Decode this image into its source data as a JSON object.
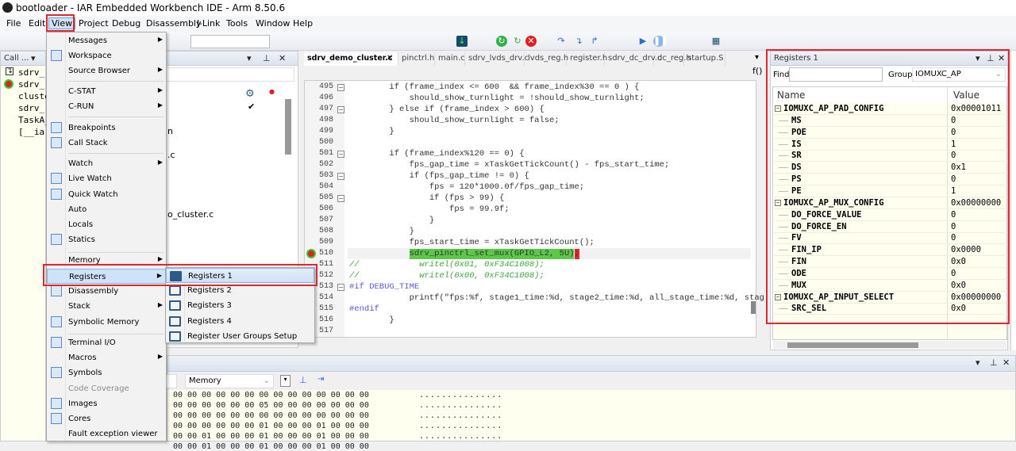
{
  "window": {
    "title": "bootloader - IAR Embedded Workbench IDE - Arm 8.50.6"
  },
  "menubar": [
    "File",
    "Edit",
    "View",
    "Project",
    "Debug",
    "Disassembly",
    "J-Link",
    "Tools",
    "Window",
    "Help"
  ],
  "callstack": {
    "title": "Call ...",
    "items": [
      "sdrv_",
      "sdrv_",
      "cluste",
      "sdrv_",
      "TaskA_",
      "[__ia"
    ]
  },
  "workspace": {
    "fragments": [
      "n",
      ".c",
      "o_cluster.c"
    ]
  },
  "editor": {
    "tabs": [
      "sdrv_demo_cluster.c",
      "pinctrl.h",
      "main.c",
      "sdrv_lvds_drv.c",
      "lvds_reg.h",
      "register.h",
      "sdrv_dc_drv.c",
      "dc_reg.h",
      "startup.S"
    ],
    "func_icon": "f()",
    "line_numbers": [
      "495",
      "496",
      "497",
      "498",
      "499",
      "500",
      "501",
      "502",
      "503",
      "504",
      "505",
      "506",
      "507",
      "508",
      "509",
      "510",
      "511",
      "512",
      "513",
      "514",
      "515",
      "516",
      "517"
    ],
    "current_line": "510",
    "lines": [
      "        if (frame_index <= 600  && frame_index%30 == 0 ) {",
      "            should_show_turnlight = !should_show_turnlight;",
      "        } else if (frame_index > 600) {",
      "            should_show_turnlight = false;",
      "        }",
      "",
      "        if (frame_index%120 == 0) {",
      "            fps_gap_time = xTaskGetTickCount() - fps_start_time;",
      "            if (fps_gap_time != 0) {",
      "                fps = 120*1000.0f/fps_gap_time;",
      "                if (fps > 99) {",
      "                    fps = 99.9f;",
      "                }",
      "            }",
      "            fps_start_time = xTaskGetTickCount();",
      "            sdrv_pinctrl_set_mux(GPIO_L2, 5U);",
      "//            writel(0x01, 0xF34C1008);",
      "//            writel(0x00, 0xF34C1008);",
      "#if DEBUG_TIME",
      "            printf(\"fps:%f, stage1_time:%d, stage2_time:%d, all_stage_time:%d, stag",
      "#endif",
      "        }",
      ""
    ]
  },
  "view_menu": {
    "items": [
      {
        "label": "Messages",
        "sub": true
      },
      {
        "label": "Workspace",
        "icon": "workspace-icon"
      },
      {
        "label": "Source Browser",
        "sub": true
      },
      {
        "label": "C-STAT",
        "sub": true
      },
      {
        "label": "C-RUN",
        "sub": true
      },
      {
        "label": "Breakpoints",
        "icon": "breakpoints-icon"
      },
      {
        "label": "Call Stack",
        "icon": "call-stack-icon"
      },
      {
        "label": "Watch",
        "sub": true
      },
      {
        "label": "Live Watch",
        "icon": "live-watch-icon"
      },
      {
        "label": "Quick Watch",
        "icon": "quick-watch-icon"
      },
      {
        "label": "Auto"
      },
      {
        "label": "Locals"
      },
      {
        "label": "Statics",
        "icon": "statics-icon"
      },
      {
        "label": "Memory",
        "sub": true
      },
      {
        "label": "Registers",
        "sub": true
      },
      {
        "label": "Disassembly",
        "icon": "disassembly-icon"
      },
      {
        "label": "Stack",
        "sub": true
      },
      {
        "label": "Symbolic Memory",
        "icon": "symbolic-memory-icon"
      },
      {
        "label": "Terminal I/O",
        "icon": "terminal-icon"
      },
      {
        "label": "Macros",
        "sub": true
      },
      {
        "label": "Symbols",
        "icon": "symbols-icon"
      },
      {
        "label": "Code Coverage",
        "disabled": true
      },
      {
        "label": "Images",
        "icon": "images-icon"
      },
      {
        "label": "Cores",
        "icon": "cores-icon"
      },
      {
        "label": "Fault exception viewer"
      }
    ],
    "highlighted": "Registers"
  },
  "registers_submenu": {
    "items": [
      "Registers 1",
      "Registers 2",
      "Registers 3",
      "Registers 4",
      "Register User Groups Setup"
    ],
    "highlighted": "Registers 1"
  },
  "registers_panel": {
    "title": "Registers 1",
    "find_label": "Find:",
    "find_value": "",
    "group_label": "Group:",
    "group_value": "IOMUXC_AP",
    "columns": [
      "Name",
      "Value"
    ],
    "rows": [
      {
        "name": "IOMUXC_AP_PAD_CONFIG",
        "value": "0x00001011",
        "group": true
      },
      {
        "name": "MS",
        "value": "0"
      },
      {
        "name": "POE",
        "value": "0"
      },
      {
        "name": "IS",
        "value": "1"
      },
      {
        "name": "SR",
        "value": "0"
      },
      {
        "name": "DS",
        "value": "0x1"
      },
      {
        "name": "PS",
        "value": "0"
      },
      {
        "name": "PE",
        "value": "1"
      },
      {
        "name": "IOMUXC_AP_MUX_CONFIG",
        "value": "0x00000000",
        "group": true
      },
      {
        "name": "DO_FORCE_VALUE",
        "value": "0"
      },
      {
        "name": "DO_FORCE_EN",
        "value": "0"
      },
      {
        "name": "FV",
        "value": "0"
      },
      {
        "name": "FIN_IP",
        "value": "0x0000"
      },
      {
        "name": "FIN",
        "value": "0x0"
      },
      {
        "name": "ODE",
        "value": "0"
      },
      {
        "name": "MUX",
        "value": "0x0"
      },
      {
        "name": "IOMUXC_AP_INPUT_SELECT",
        "value": "0x00000000",
        "group": true
      },
      {
        "name": "SRC_SEL",
        "value": "0x0"
      }
    ]
  },
  "memory_panel": {
    "memory_select": "Memory",
    "rows": [
      {
        "hex": "00 00 00 00 00 00 00 00 00 00 00 00 00 00",
        "ascii": "..............."
      },
      {
        "hex": "00 00 00 00 00 00 05 00 00 00 00 00 00 00",
        "ascii": "..............."
      },
      {
        "hex": "00 00 00 00 00 00 00 00 00 00 00 00 00 00",
        "ascii": "..............."
      },
      {
        "hex": "00 00 00 00 00 00 01 00 00 00 01 00 00 00",
        "ascii": "..............."
      },
      {
        "hex": "00 00 01 00 00 00 01 00 00 00 01 00 00 00",
        "ascii": "..............."
      },
      {
        "hex": "00 00 01 00 00 00 01 00 00 00 01 00 00 00",
        "ascii": ""
      }
    ]
  },
  "colors": {
    "highlight_red": "#e0262e",
    "exec_line_green": "#5cc84a",
    "menu_highlight": "#cfe3f8",
    "register_bg": "#fffff0"
  }
}
